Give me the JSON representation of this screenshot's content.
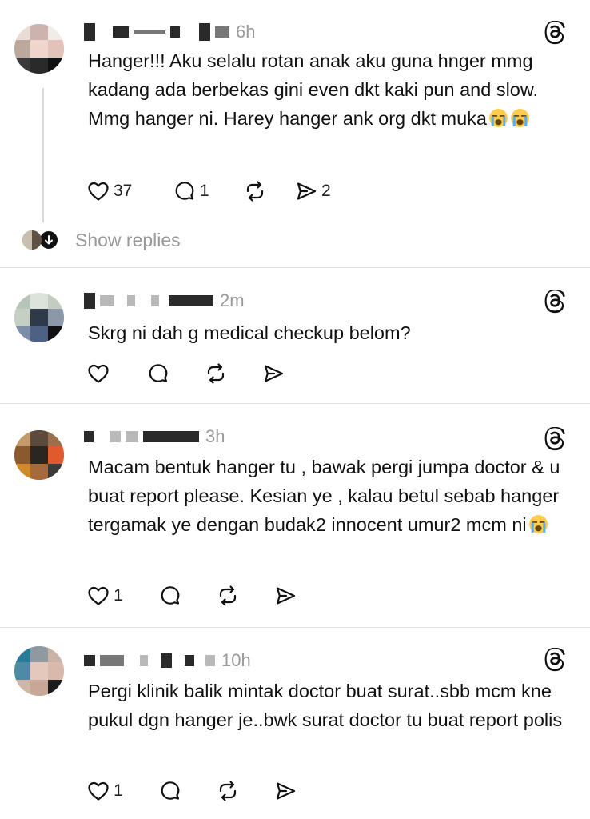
{
  "posts": [
    {
      "time": "6h",
      "text": "Hanger!!! Aku selalu rotan anak aku guna hnger mmg kadang ada berbekas gini even dkt kaki pun and slow. Mmg hanger ni. Harey hanger ank org dkt muka",
      "emojis": [
        "loudly-crying-face",
        "loudly-crying-face"
      ],
      "likes": "37",
      "comments": "1",
      "reposts": "",
      "shares": "2"
    },
    {
      "time": "2m",
      "text": "Skrg ni dah g medical checkup belom?",
      "likes": "",
      "comments": "",
      "reposts": "",
      "shares": ""
    },
    {
      "time": "3h",
      "text": "Macam bentuk hanger tu , bawak pergi jumpa doctor & u buat report please. Kesian ye , kalau betul sebab hanger tergamak ye dengan budak2 innocent umur2 mcm ni",
      "emojis": [
        "loudly-crying-face"
      ],
      "likes": "1",
      "comments": "",
      "reposts": "",
      "shares": ""
    },
    {
      "time": "10h",
      "text": "Pergi klinik balik mintak doctor buat surat..sbb mcm kne pukul dgn hanger je..bwk surat doctor tu buat report polis",
      "likes": "1",
      "comments": "",
      "reposts": "",
      "shares": ""
    }
  ],
  "show_replies_label": "Show replies",
  "colors": {
    "text": "#101010",
    "muted": "#999999",
    "divider": "#e2e2e2",
    "icon": "#111111"
  }
}
